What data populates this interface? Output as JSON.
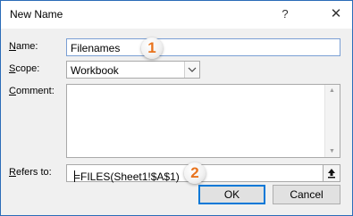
{
  "window": {
    "title": "New Name",
    "help_label": "?",
    "close_label": "✕"
  },
  "form": {
    "name_label_first": "N",
    "name_label_rest": "ame:",
    "name_value": "Filenames",
    "scope_label_first": "S",
    "scope_label_rest": "cope:",
    "scope_value": "Workbook",
    "comment_label_first": "C",
    "comment_label_rest": "omment:",
    "comment_value": "",
    "refers_label_first": "R",
    "refers_label_rest": "efers to:",
    "refers_value": "=FILES(Sheet1!$A$1)"
  },
  "buttons": {
    "ok_label": "OK",
    "cancel_label": "Cancel"
  },
  "markers": {
    "one": "1",
    "two": "2"
  },
  "colors": {
    "accent": "#0078d7",
    "marker_text": "#e8731d",
    "dialog_border": "#2b6cb8"
  },
  "icons": {
    "scope_dropdown": "chevron-down-icon",
    "collapse_dialog": "collapse-dialog-icon",
    "scroll_up": "scroll-up-arrow-icon",
    "scroll_down": "scroll-down-arrow-icon"
  }
}
